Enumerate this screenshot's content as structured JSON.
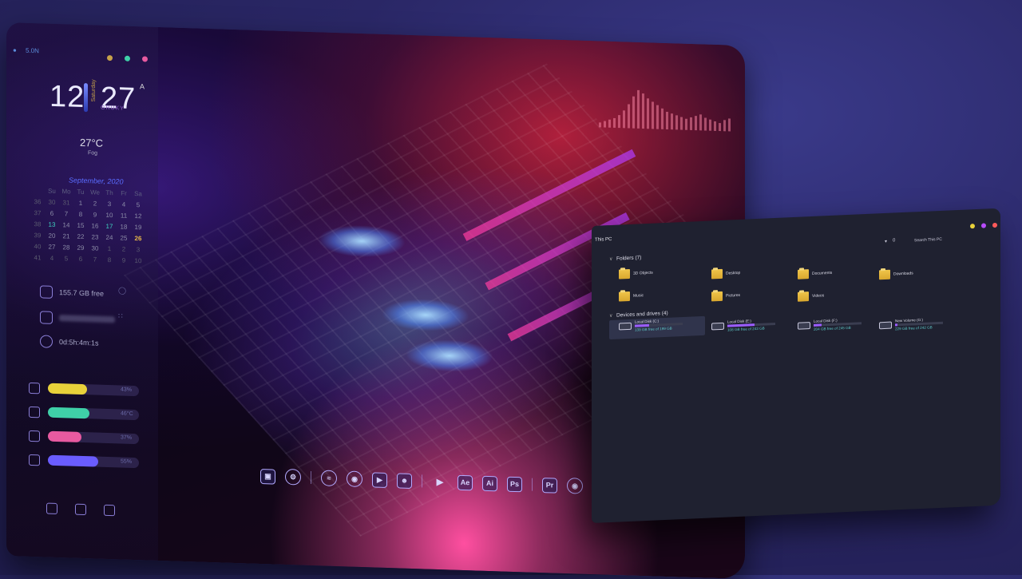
{
  "sidebar": {
    "network": "5.0N",
    "clock": {
      "hour": "12",
      "minute": "27",
      "ampm": "A",
      "day": "Saturday",
      "brand": "GRUKY"
    },
    "weather": {
      "temp": "27°C",
      "condition": "Fog"
    },
    "calendar": {
      "title": "September, 2020",
      "headers": [
        "Su",
        "Mo",
        "Tu",
        "We",
        "Th",
        "Fr",
        "Sa"
      ],
      "weeks": [
        [
          "36",
          "30",
          "31",
          "1",
          "2",
          "3",
          "4",
          "5"
        ],
        [
          "37",
          "6",
          "7",
          "8",
          "9",
          "10",
          "11",
          "12"
        ],
        [
          "38",
          "13",
          "14",
          "15",
          "16",
          "17",
          "18",
          "19"
        ],
        [
          "39",
          "20",
          "21",
          "22",
          "23",
          "24",
          "25",
          "26"
        ],
        [
          "40",
          "27",
          "28",
          "29",
          "30",
          "1",
          "2",
          "3"
        ],
        [
          "41",
          "4",
          "5",
          "6",
          "7",
          "8",
          "9",
          "10"
        ]
      ]
    },
    "stats": {
      "disk_free": "155.7 GB free",
      "uptime": "0d:5h:4m:1s"
    },
    "meters": [
      {
        "name": "cpu",
        "label": "43%",
        "percent": 43,
        "color": "#e8d13a"
      },
      {
        "name": "temp",
        "label": "46°C",
        "percent": 46,
        "color": "#3fd0a8"
      },
      {
        "name": "ram",
        "label": "37%",
        "percent": 37,
        "color": "#e85aa0"
      },
      {
        "name": "gpu",
        "label": "55%",
        "percent": 55,
        "color": "#6a5cff"
      }
    ]
  },
  "dock": {
    "items": [
      "display",
      "settings",
      "spotify",
      "browser",
      "youtube",
      "discord",
      "player",
      "Ae",
      "Ai",
      "Ps",
      "Pr",
      "camera"
    ]
  },
  "explorer": {
    "title": "This PC",
    "search_placeholder": "Search This PC",
    "view_count": "0",
    "folders_header": "Folders (7)",
    "folders": [
      "3D Objects",
      "Desktop",
      "Documents",
      "Downloads",
      "Music",
      "Pictures",
      "Videos"
    ],
    "drives_header": "Devices and drives (4)",
    "drives": [
      {
        "name": "Local Disk (C:)",
        "free": "139 GB free of 199 GB",
        "used_percent": 30
      },
      {
        "name": "Local Disk (E:)",
        "free": "108 GB free of 243 GB",
        "used_percent": 56
      },
      {
        "name": "Local Disk (F:)",
        "free": "204 GB free of 245 GB",
        "used_percent": 17
      },
      {
        "name": "New Volume (G:)",
        "free": "229 GB free of 242 GB",
        "used_percent": 5
      }
    ],
    "colors": {
      "dot1": "#e8d13a",
      "dot2": "#b84cff",
      "dot3": "#ff5a5a"
    }
  }
}
